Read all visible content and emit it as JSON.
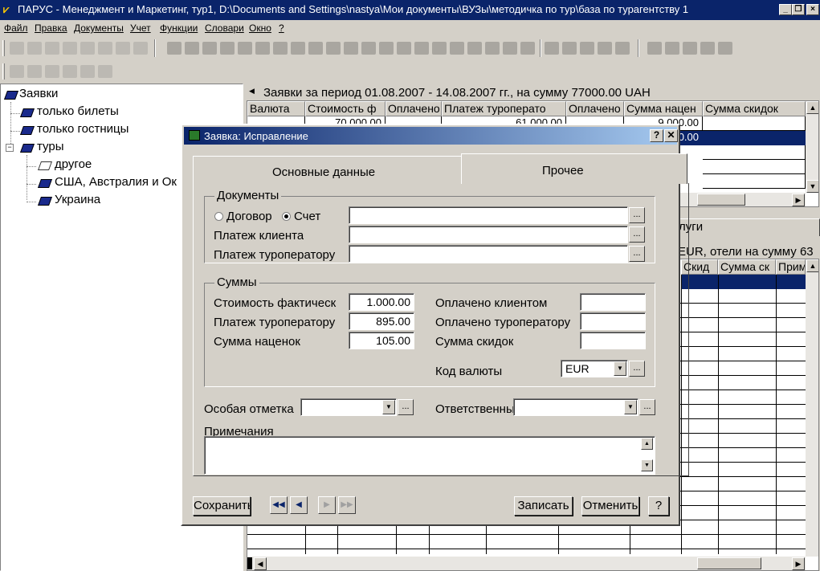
{
  "window": {
    "title": "ПАРУС - Менеджмент и Маркетинг, тур1, D:\\Documents and Settings\\nastya\\Мои документы\\ВУЗы\\методичка по тур\\база по турагентству 1"
  },
  "menu": [
    "Файл",
    "Правка",
    "Документы",
    "Учет",
    "Функции",
    "Словари",
    "Окно",
    "?"
  ],
  "tree": {
    "root": "Заявки",
    "items": [
      "только билеты",
      "только гостницы",
      "туры"
    ],
    "children": [
      "другое",
      "США, Австралия и Ок",
      "Украина"
    ]
  },
  "upper_grid": {
    "title": "Заявки за период 01.08.2007 - 14.08.2007 гг., на сумму 77000.00 UAH",
    "columns": [
      "Валюта",
      "Стоимость ф",
      "Оплачено",
      "Платеж туроперато",
      "Оплачено",
      "Сумма нацен",
      "Сумма скидок"
    ],
    "rows": [
      [
        "",
        "70 000.00",
        "",
        "61 000.00",
        "",
        "9 000.00",
        ""
      ],
      [
        "",
        "",
        "",
        "",
        "",
        "0.00",
        ""
      ]
    ]
  },
  "lower_grid": {
    "tab_fragment": "луги",
    "title_fragment": "EUR, отели на сумму 63",
    "columns": [
      "Скид",
      "Сумма ск",
      "Прим"
    ]
  },
  "dialog": {
    "title": "Заявка: Исправление",
    "tabs": [
      "Основные данные",
      "Прочее"
    ],
    "active_tab": 1,
    "documents": {
      "legend": "Документы",
      "radio_contract": "Договор",
      "radio_invoice": "Счет",
      "selected": "Счет",
      "client_payment_label": "Платеж клиента",
      "operator_payment_label": "Платеж туроператору"
    },
    "sums": {
      "legend": "Суммы",
      "actual_cost_label": "Стоимость фактическ",
      "actual_cost": "1.000.00",
      "operator_payment_label": "Платеж туроператору",
      "operator_payment": "895.00",
      "markup_label": "Сумма наценок",
      "markup": "105.00",
      "paid_client_label": "Оплачено клиентом",
      "paid_operator_label": "Оплачено туроператору",
      "discounts_label": "Сумма скидок",
      "currency_label": "Код валюты",
      "currency": "EUR"
    },
    "special_mark_label": "Особая отметка",
    "responsible_label": "Ответственный",
    "notes_label": "Примечания",
    "buttons": {
      "save": "Сохранить",
      "write": "Записать",
      "cancel": "Отменить",
      "help": "?"
    }
  }
}
